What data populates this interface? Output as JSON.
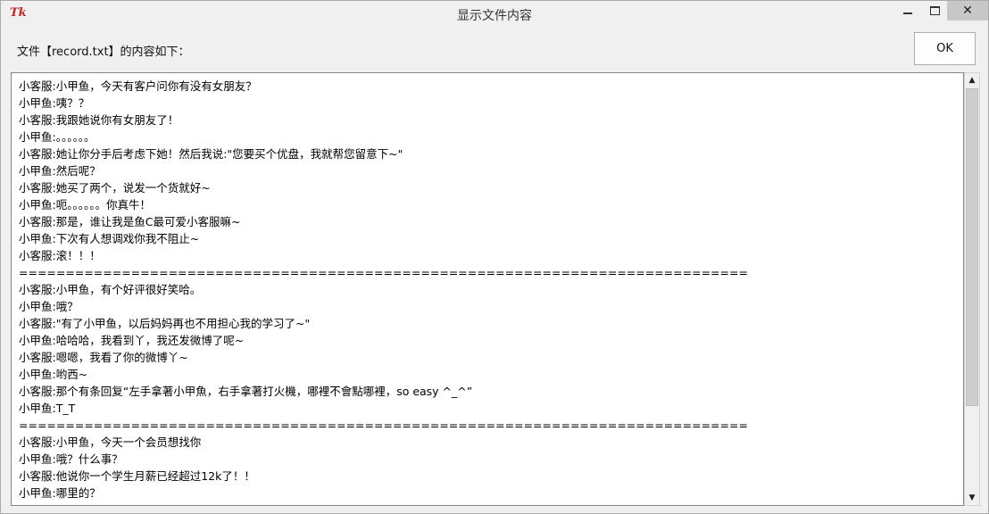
{
  "window": {
    "title": "显示文件内容",
    "logo": "Tk",
    "controls": {
      "minimize": "",
      "maximize": "",
      "close": "✕"
    }
  },
  "header": {
    "prompt": "文件【record.txt】的内容如下：",
    "ok_label": "OK"
  },
  "content": {
    "lines": [
      "小客服:小甲鱼，今天有客户问你有没有女朋友？",
      "小甲鱼:咦？？",
      "小客服:我跟她说你有女朋友了！",
      "小甲鱼:。。。。。。",
      "小客服:她让你分手后考虑下她！然后我说:\"您要买个优盘，我就帮您留意下~\"",
      "小甲鱼:然后呢？",
      "小客服:她买了两个，说发一个货就好~",
      "小甲鱼:呃。。。。。。你真牛！",
      "小客服:那是，谁让我是鱼C最可爱小客服嘛~",
      "小甲鱼:下次有人想调戏你我不阻止~",
      "小客服:滚！！！",
      "==============================================================================",
      "小客服:小甲鱼，有个好评很好笑哈。",
      "小甲鱼:哦？",
      "小客服:\"有了小甲鱼，以后妈妈再也不用担心我的学习了~\"",
      "小甲鱼:哈哈哈，我看到丫，我还发微博了呢~",
      "小客服:嗯嗯，我看了你的微博丫~",
      "小甲鱼:哟西~",
      "小客服:那个有条回复“左手拿著小甲魚，右手拿著打火機，哪裡不會點哪裡，so easy ^_^”",
      "小甲鱼:T_T",
      "==============================================================================",
      "小客服:小甲鱼，今天一个会员想找你",
      "小甲鱼:哦？什么事？",
      "小客服:他说你一个学生月薪已经超过12k了！！",
      "小甲鱼:哪里的？"
    ]
  },
  "scrollbar": {
    "up_arrow": "▲",
    "down_arrow": "▼"
  }
}
